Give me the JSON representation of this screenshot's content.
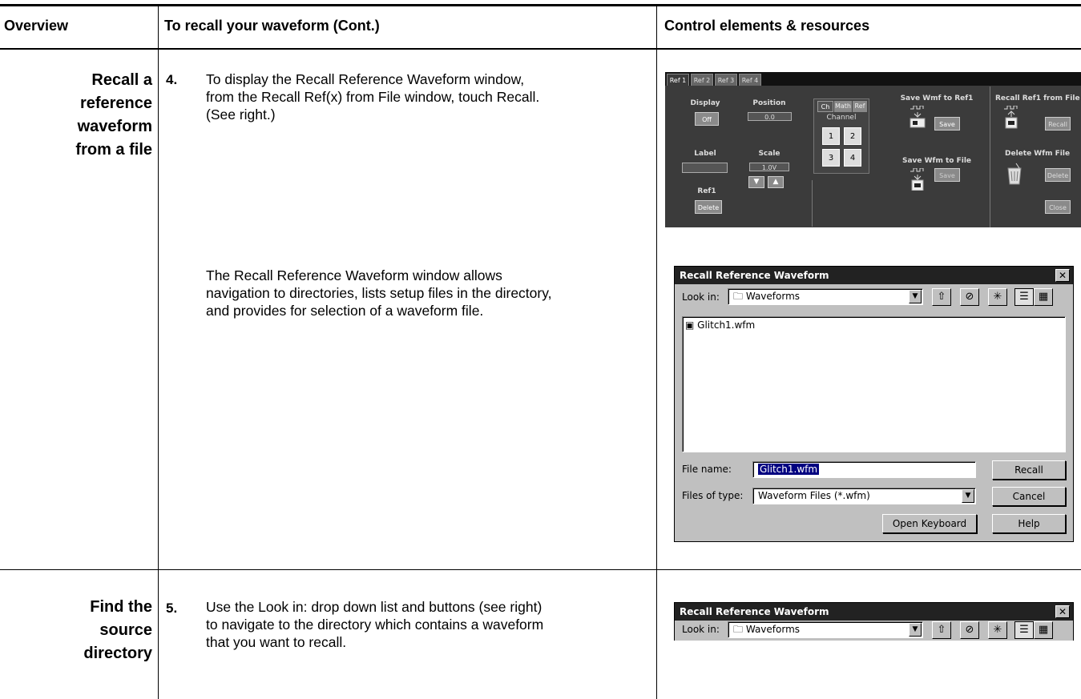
{
  "header": {
    "col1": "Overview",
    "col2": "To recall your waveform (Cont.)",
    "col3": "Control elements & resources"
  },
  "section1": {
    "title_lines": [
      "Recall a",
      "reference",
      "waveform",
      "from a file"
    ],
    "step_number": "4.",
    "step_lines": [
      "To display the Recall Reference Waveform window,",
      "from the Recall Ref(x) from File window, touch Recall.",
      "(See right.)"
    ],
    "para_lines": [
      "The Recall Reference Waveform window allows",
      "navigation to directories, lists setup files in the directory,",
      "and provides for selection of a waveform file."
    ]
  },
  "section2": {
    "title_lines": [
      "Find the",
      "source",
      "directory"
    ],
    "step_number": "5.",
    "step_lines": [
      "Use the Look in: drop down list and buttons (see right)",
      "to navigate to the directory which contains a waveform",
      "that you want to recall."
    ]
  },
  "panel": {
    "tabs": [
      "Ref 1",
      "Ref 2",
      "Ref 3",
      "Ref 4"
    ],
    "display_label": "Display",
    "display_button": "Off",
    "position_label": "Position",
    "position_value": "0.0",
    "label_label": "Label",
    "scale_label": "Scale",
    "scale_value": "1.0V",
    "ref1_label": "Ref1",
    "delete_button": "Delete",
    "source_tabs": [
      "Ch",
      "Math",
      "Ref"
    ],
    "channel_label": "Channel",
    "channels": [
      "1",
      "2",
      "3",
      "4"
    ],
    "save_wfm_ref_label": "Save Wmf to Ref1",
    "save_button": "Save",
    "save_wfm_file_label": "Save Wfm to File",
    "save_file_button": "Save",
    "recall_label": "Recall Ref1 from File",
    "recall_button": "Recall",
    "delete_wfm_label": "Delete Wfm File",
    "delete_file_button": "Delete",
    "close_button": "Close"
  },
  "dialog1": {
    "title": "Recall Reference Waveform",
    "look_in_label": "Look in:",
    "look_in_value": "Waveforms",
    "files": [
      "Glitch1.wfm"
    ],
    "file_name_label": "File name:",
    "file_name_value": "Glitch1.wfm",
    "files_of_type_label": "Files of type:",
    "files_of_type_value": "Waveform Files (*.wfm)",
    "recall_button": "Recall",
    "cancel_button": "Cancel",
    "open_keyboard_button": "Open Keyboard",
    "help_button": "Help"
  },
  "dialog2": {
    "title": "Recall Reference Waveform",
    "look_in_label": "Look in:",
    "look_in_value": "Waveforms"
  }
}
